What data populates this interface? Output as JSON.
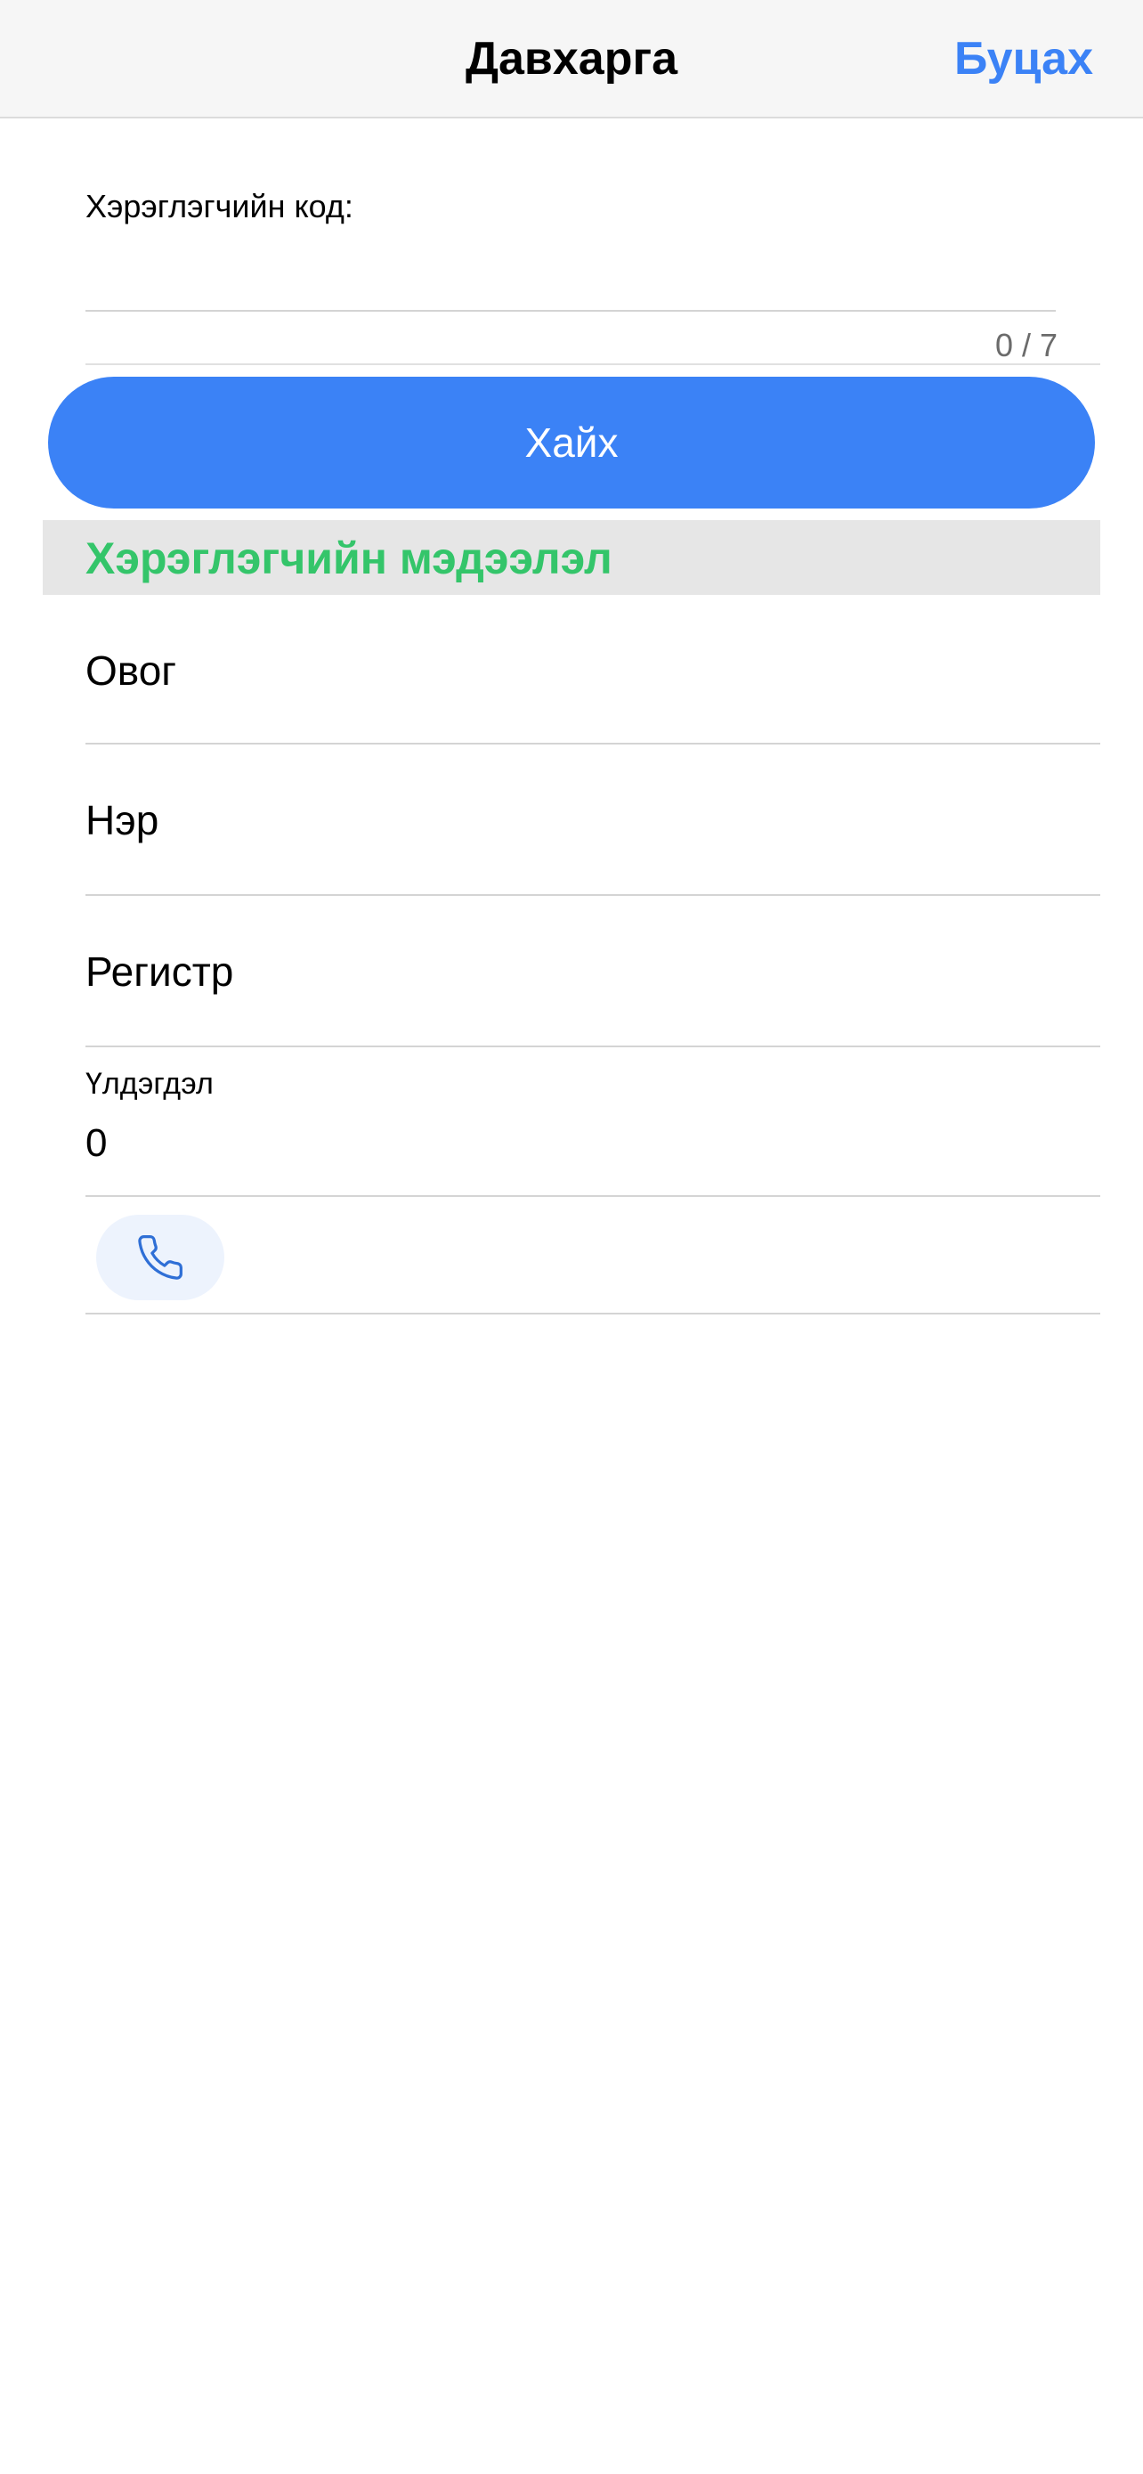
{
  "header": {
    "title": "Давхарга",
    "back_label": "Буцах"
  },
  "search": {
    "field_label": "Хэрэглэгчийн код:",
    "value": "",
    "counter": "0 / 7",
    "button_label": "Хайх"
  },
  "user_info": {
    "section_title": "Хэрэглэгчийн мэдээлэл",
    "last_name_label": "Овог",
    "first_name_label": "Нэр",
    "register_label": "Регистр",
    "balance_label": "Үлдэгдэл",
    "balance_value": "0"
  },
  "icons": {
    "call": "phone-icon"
  },
  "colors": {
    "accent": "#3b82f6",
    "section_title": "#34c56a",
    "section_bg": "#e6e6e6",
    "navbar_bg": "#f6f6f6"
  }
}
